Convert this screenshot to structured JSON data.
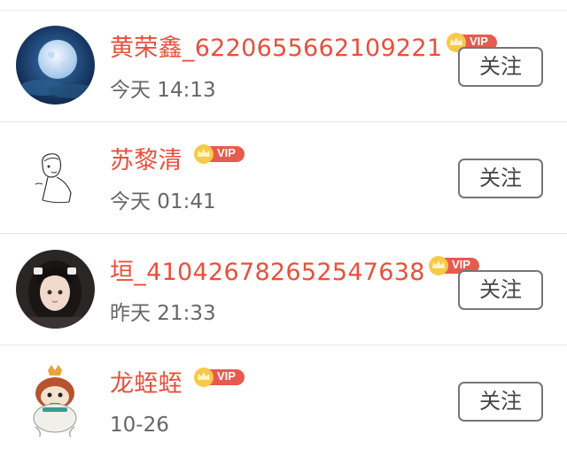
{
  "follow_label": "关注",
  "vip_label": "VIP",
  "accent_color": "#e8503a",
  "users": [
    {
      "name": "黄荣鑫_6220655662109221",
      "time": "今天 14:13"
    },
    {
      "name": "苏黎清",
      "time": "今天 01:41"
    },
    {
      "name": "垣_410426782652547638",
      "time": "昨天 21:33"
    },
    {
      "name": "龙蛭蛭",
      "time": "10-26"
    }
  ]
}
